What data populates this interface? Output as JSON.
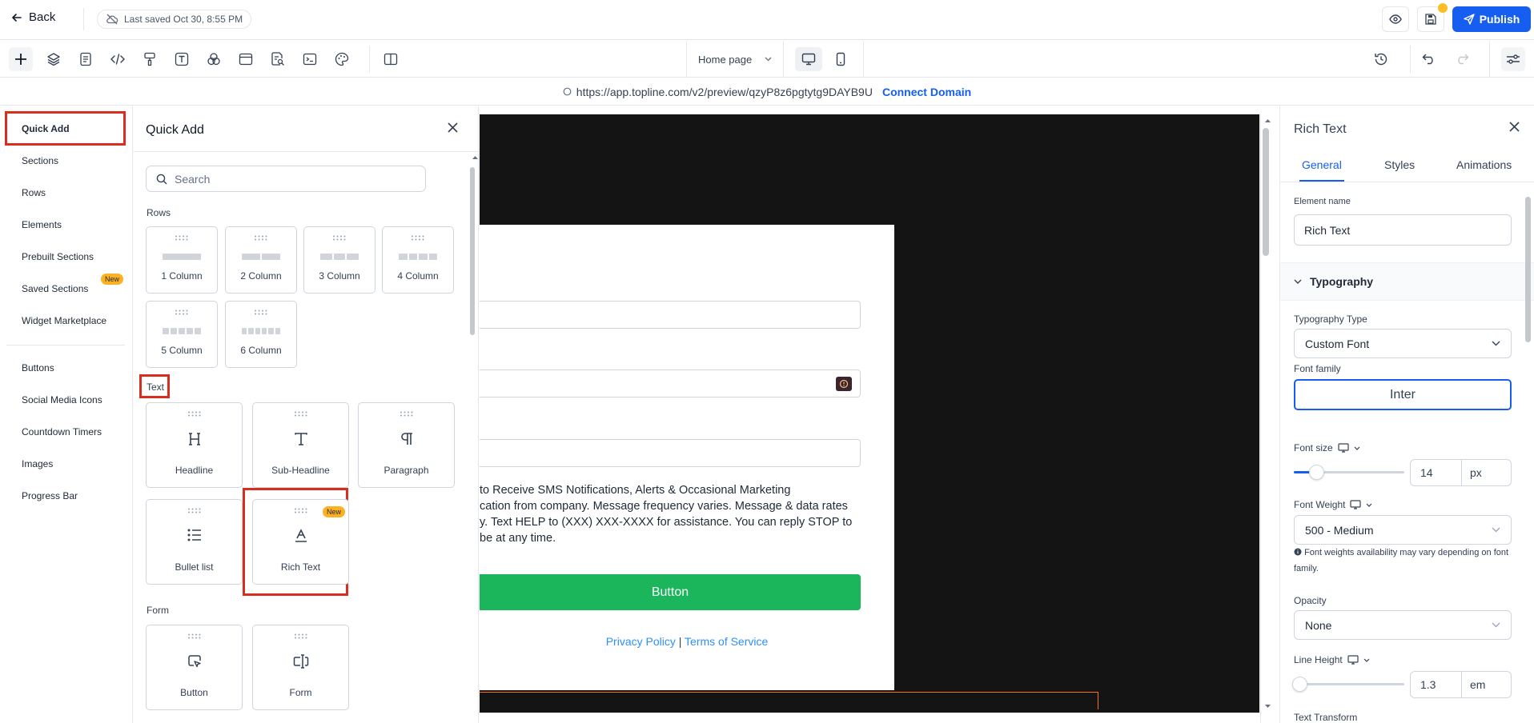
{
  "topbar": {
    "back_label": "Back",
    "saved_label": "Last saved Oct 30, 8:55 PM",
    "publish_label": "Publish"
  },
  "toolbar": {
    "page_select": "Home page"
  },
  "urlbar": {
    "url": "https://app.topline.com/v2/preview/qzyP8z6pgtytg9DAYB9U",
    "connect_domain": "Connect Domain"
  },
  "leftnav": {
    "items": [
      {
        "label": "Quick Add"
      },
      {
        "label": "Sections"
      },
      {
        "label": "Rows"
      },
      {
        "label": "Elements"
      },
      {
        "label": "Prebuilt Sections"
      },
      {
        "label": "Saved Sections",
        "badge": "New"
      },
      {
        "label": "Widget Marketplace"
      },
      {
        "label": "Buttons"
      },
      {
        "label": "Social Media Icons"
      },
      {
        "label": "Countdown Timers"
      },
      {
        "label": "Images"
      },
      {
        "label": "Progress Bar"
      }
    ]
  },
  "quickadd": {
    "title": "Quick Add",
    "search_placeholder": "Search",
    "rows_label": "Rows",
    "rows": [
      "1 Column",
      "2 Column",
      "3 Column",
      "4 Column",
      "5 Column",
      "6 Column"
    ],
    "text_label": "Text",
    "text_items": [
      "Headline",
      "Sub-Headline",
      "Paragraph",
      "Bullet list",
      "Rich Text"
    ],
    "rich_text_badge": "New",
    "form_label": "Form",
    "form_items": [
      "Button",
      "Form"
    ]
  },
  "canvas": {
    "sms_lines": [
      "to Receive SMS Notifications, Alerts & Occasional Marketing",
      "cation from company. Message frequency varies. Message & data rates",
      "y. Text HELP to (XXX) XXX-XXXX for assistance. You can reply STOP to",
      "be at any time."
    ],
    "button_label": "Button",
    "privacy": "Privacy Policy",
    "sep": "|",
    "terms": "Terms of Service"
  },
  "rightpanel": {
    "title": "Rich Text",
    "tabs": [
      "General",
      "Styles",
      "Animations"
    ],
    "element_name_label": "Element name",
    "element_name_value": "Rich Text",
    "typography_label": "Typography",
    "typography_type_label": "Typography Type",
    "typography_type_value": "Custom Font",
    "font_family_label": "Font family",
    "font_family_value": "Inter",
    "font_size_label": "Font size",
    "font_size_value": "14",
    "font_size_unit": "px",
    "font_size_slider": 0.15,
    "font_weight_label": "Font Weight",
    "font_weight_value": "500 - Medium",
    "font_weight_note": "Font weights availability may vary depending on font family.",
    "opacity_label": "Opacity",
    "opacity_value": "None",
    "line_height_label": "Line Height",
    "line_height_value": "1.3",
    "line_height_unit": "em",
    "line_height_slider": 0.0,
    "text_transform_label": "Text Transform"
  }
}
